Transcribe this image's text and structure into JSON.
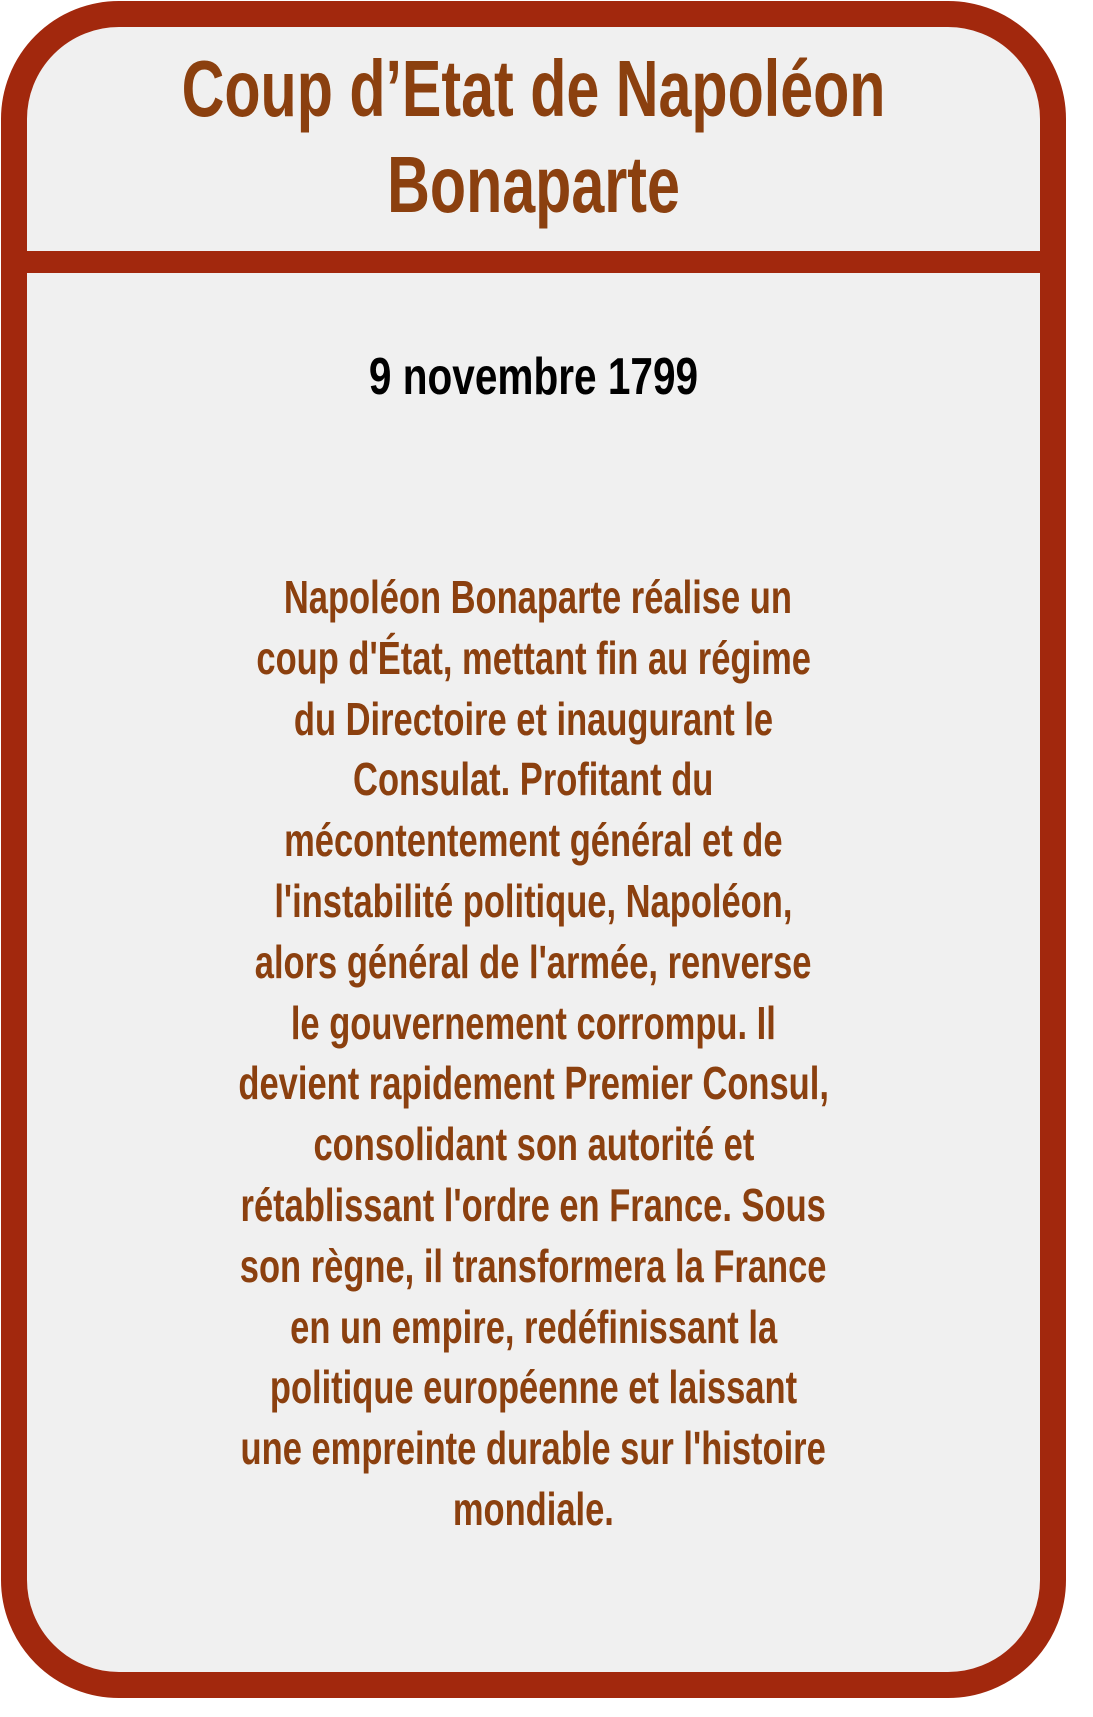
{
  "card": {
    "title_line1": "Coup d’Etat de Napoléon",
    "title_line2": "Bonaparte",
    "date": "9 novembre 1799",
    "description_lines": [
      " Napoléon Bonaparte réalise un",
      "coup d'État, mettant fin au régime",
      "du Directoire et inaugurant le",
      "Consulat. Profitant du",
      "mécontentement général et de",
      "l'instabilité politique, Napoléon,",
      "alors général de l'armée, renverse",
      "le gouvernement corrompu. Il",
      "devient rapidement Premier Consul,",
      "consolidant son autorité et",
      "rétablissant l'ordre en France. Sous",
      "son règne, il transformera la France",
      "en un empire, redéfinissant la",
      "politique européenne et laissant",
      "une empreinte durable sur l'histoire",
      "mondiale."
    ]
  },
  "colors": {
    "border": "#a2280d",
    "text_brown": "#8b400f",
    "background": "#f0f0f0",
    "date_text": "#000000"
  }
}
